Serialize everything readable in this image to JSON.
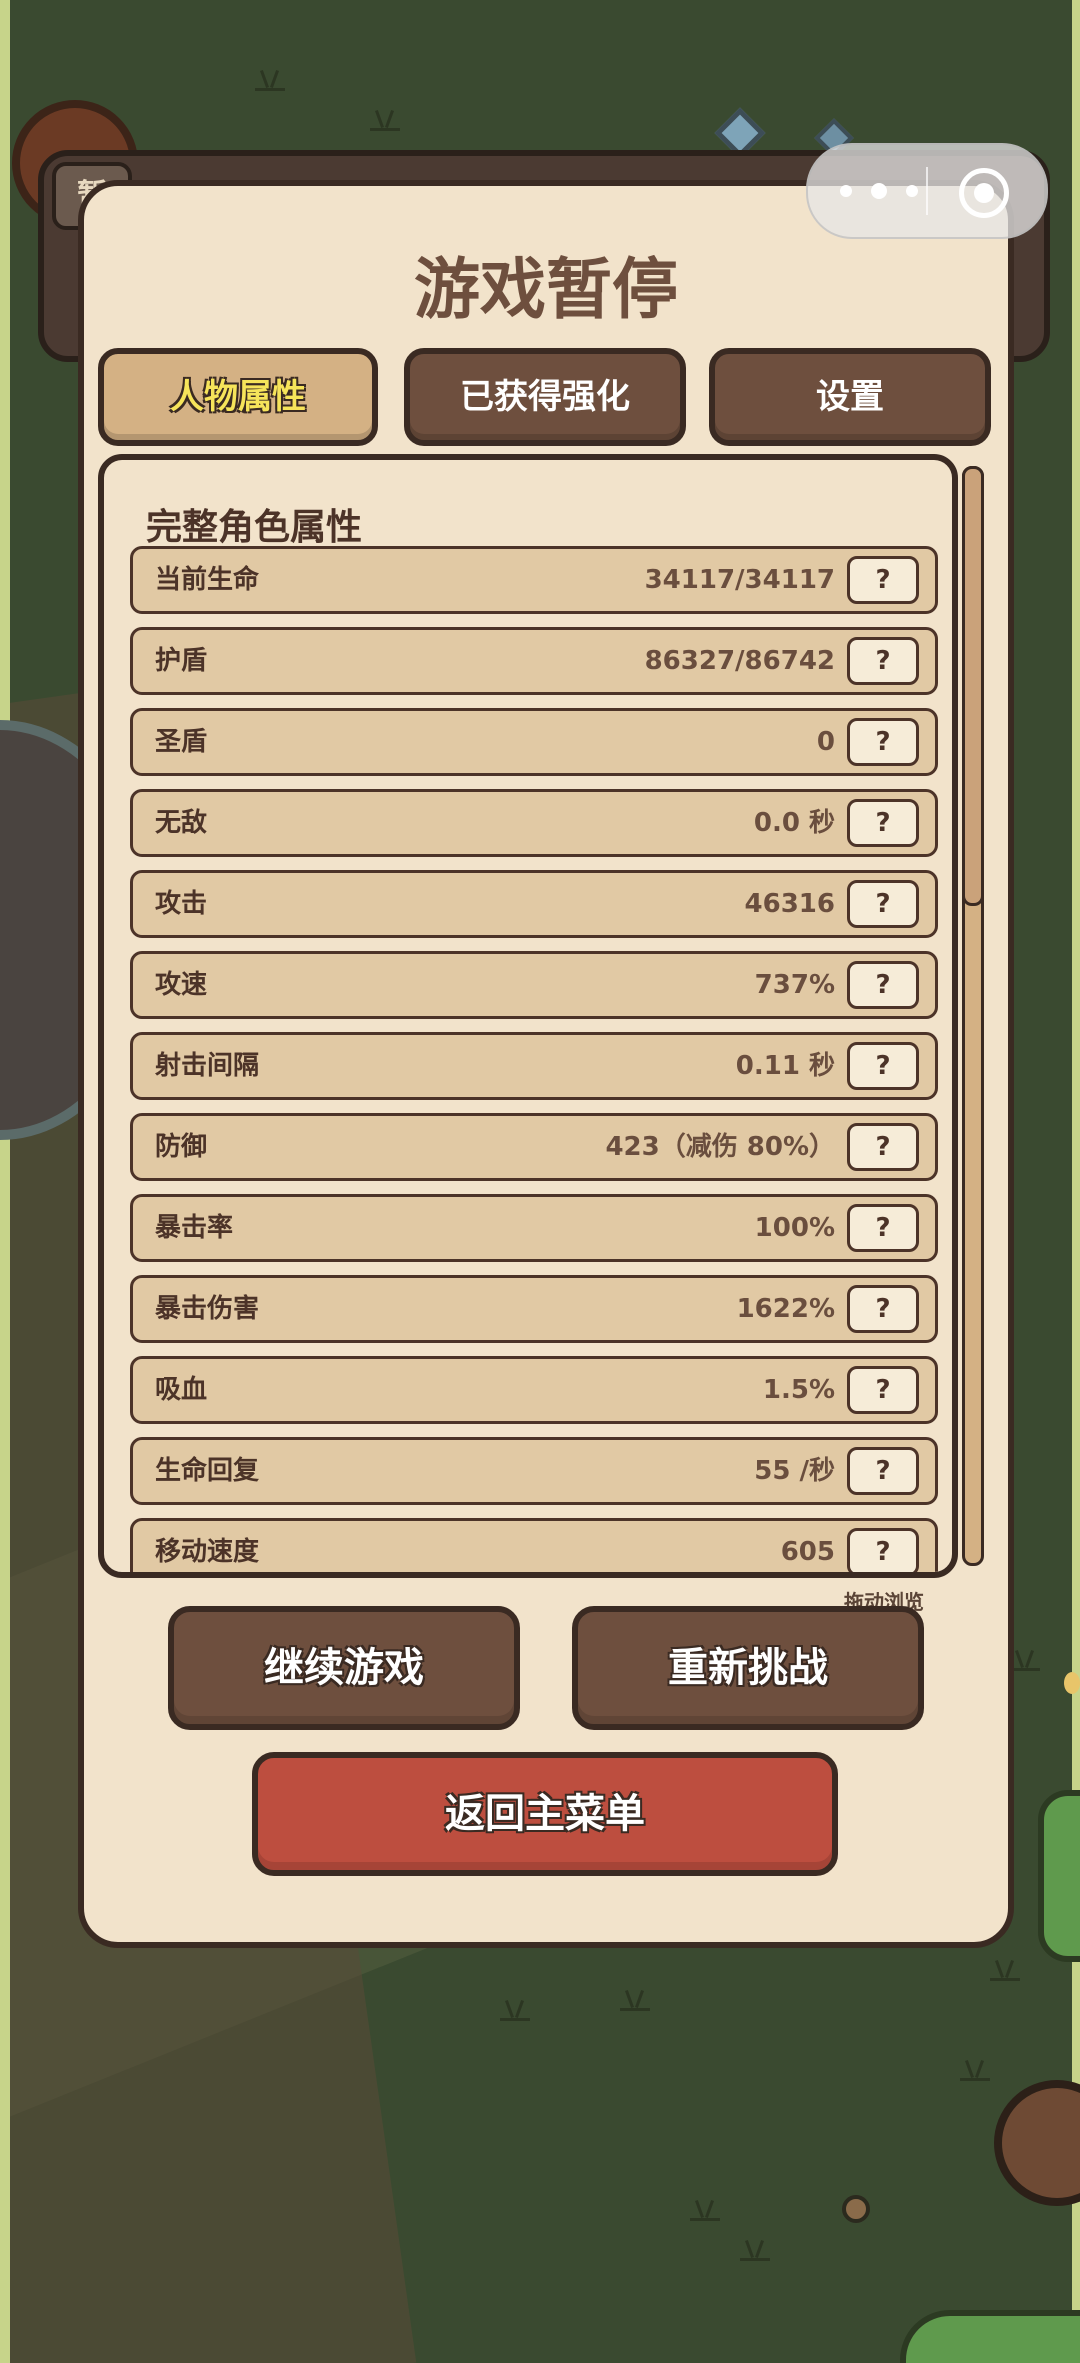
{
  "hud": {
    "tab_label": "暂"
  },
  "modal": {
    "title": "游戏暂停",
    "tabs": [
      {
        "label": "人物属性",
        "active": true
      },
      {
        "label": "已获得强化",
        "active": false
      },
      {
        "label": "设置",
        "active": false
      }
    ],
    "panel_title": "完整角色属性",
    "help_label": "?",
    "stats": [
      {
        "label": "当前生命",
        "value": "34117/34117"
      },
      {
        "label": "护盾",
        "value": "86327/86742"
      },
      {
        "label": "圣盾",
        "value": "0"
      },
      {
        "label": "无敌",
        "value": "0.0 秒"
      },
      {
        "label": "攻击",
        "value": "46316"
      },
      {
        "label": "攻速",
        "value": "737%"
      },
      {
        "label": "射击间隔",
        "value": "0.11 秒"
      },
      {
        "label": "防御",
        "value": "423（减伤 80%）"
      },
      {
        "label": "暴击率",
        "value": "100%"
      },
      {
        "label": "暴击伤害",
        "value": "1622%"
      },
      {
        "label": "吸血",
        "value": "1.5%"
      },
      {
        "label": "生命回复",
        "value": "55 /秒"
      },
      {
        "label": "移动速度",
        "value": "605"
      }
    ],
    "scroll_hint": "拖动浏览",
    "buttons": {
      "continue": "继续游戏",
      "retry": "重新挑战",
      "main_menu": "返回主菜单"
    }
  },
  "colors": {
    "modal_bg": "#f2e3cb",
    "button_brown": "#6e4f3e",
    "button_red": "#bd4e3f",
    "active_tab": "#d4b184",
    "active_tab_text": "#f6e45a"
  }
}
